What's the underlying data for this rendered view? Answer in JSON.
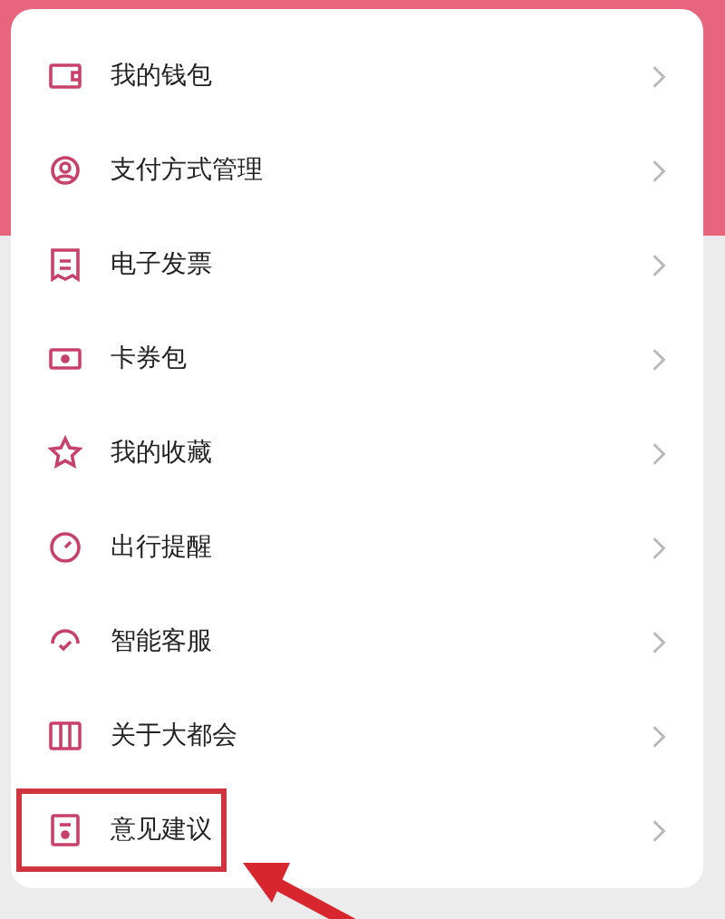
{
  "menu": {
    "items": [
      {
        "label": "我的钱包",
        "highlighted": false
      },
      {
        "label": "支付方式管理",
        "highlighted": false
      },
      {
        "label": "电子发票",
        "highlighted": false
      },
      {
        "label": "卡券包",
        "highlighted": false
      },
      {
        "label": "我的收藏",
        "highlighted": false
      },
      {
        "label": "出行提醒",
        "highlighted": false
      },
      {
        "label": "智能客服",
        "highlighted": false
      },
      {
        "label": "关于大都会",
        "highlighted": false
      },
      {
        "label": "意见建议",
        "highlighted": true
      }
    ]
  }
}
